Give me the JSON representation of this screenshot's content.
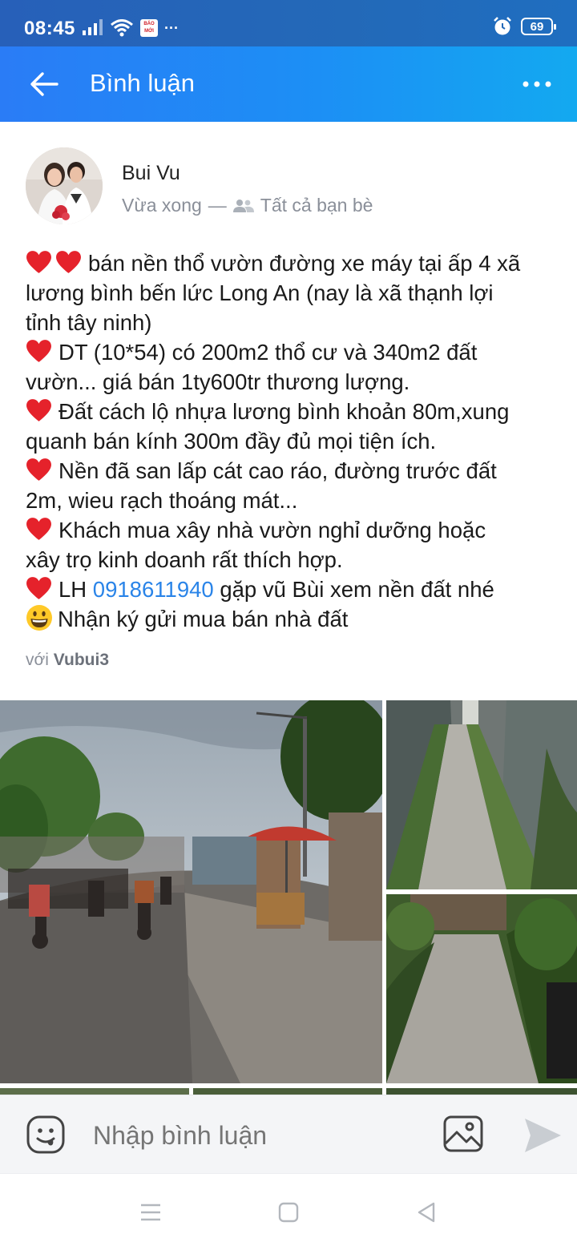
{
  "status_bar": {
    "time": "08:45",
    "news_badge": "BÁO MỚI",
    "overflow": "···",
    "battery": "69"
  },
  "app_bar": {
    "title": "Bình luận"
  },
  "post": {
    "author": "Bui Vu",
    "time": "Vừa xong",
    "separator": "—",
    "privacy": "Tất cả bạn bè",
    "content": [
      {
        "hearts": 2,
        "text": "bán nền thổ vườn đường xe máy tại ấp 4 xã"
      },
      {
        "text": "lương bình bến lức Long An (nay là xã thạnh lợi"
      },
      {
        "text": "tỉnh tây ninh)"
      },
      {
        "hearts": 1,
        "text": "DT (10*54) có 200m2 thổ cư và 340m2 đất"
      },
      {
        "text": "vườn... giá bán 1ty600tr thương lượng."
      },
      {
        "hearts": 1,
        "text": "Đất cách lộ nhựa lương bình khoản 80m,xung"
      },
      {
        "text": "quanh bán kính 300m đầy đủ mọi tiện ích."
      },
      {
        "hearts": 1,
        "text": "Nền đã san lấp cát cao ráo, đường trước đất"
      },
      {
        "text": "2m, wieu rạch thoáng mát..."
      },
      {
        "hearts": 1,
        "text": "Khách mua xây nhà vườn nghỉ dưỡng hoặc"
      },
      {
        "text": "xây trọ kinh doanh rất thích hợp."
      },
      {
        "hearts": 1,
        "text": "LH ",
        "phone": "0918611940",
        "text_after": " gặp vũ Bùi xem nền đất nhé"
      },
      {
        "smile": true,
        "text": "Nhận ký gửi mua bán nhà đất"
      }
    ],
    "tagged_prefix": "với",
    "tagged_user": "Vubui3"
  },
  "comment_bar": {
    "placeholder": "Nhập bình luận"
  },
  "colors": {
    "accent": "#2a7cf6",
    "link": "#2a84e8",
    "heart": "#e5222b"
  },
  "icons": [
    "back-arrow-icon",
    "more-icon",
    "signal-icon",
    "wifi-icon",
    "alarm-icon",
    "friends-icon",
    "heart-icon",
    "smile-emoji-icon",
    "sticker-icon",
    "image-icon",
    "send-icon",
    "menu-icon",
    "home-icon",
    "back-icon"
  ]
}
